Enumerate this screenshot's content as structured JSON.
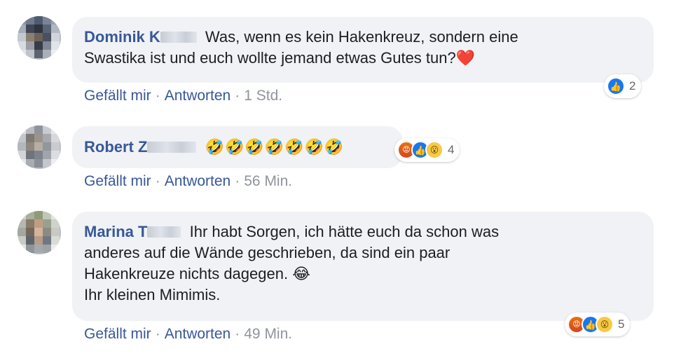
{
  "comments": [
    {
      "author": "Dominik K",
      "text_line1": "Was, wenn es kein Hakenkreuz, sondern eine",
      "text_line2": "Swastika ist und euch wollte jemand etwas Gutes tun?",
      "heart": "❤️",
      "like": "Gefällt mir",
      "reply": "Antworten",
      "time": "1 Std.",
      "reaction_count": "2",
      "reactions": [
        "like-icon"
      ]
    },
    {
      "author": "Robert Z",
      "emojis": "🤣🤣🤣🤣🤣🤣🤣",
      "like": "Gefällt mir",
      "reply": "Antworten",
      "time": "56 Min.",
      "reaction_count": "4",
      "reactions": [
        "angry-icon",
        "like-icon",
        "wow-icon"
      ]
    },
    {
      "author": "Marina T",
      "text_line1": "Ihr habt Sorgen, ich hätte euch da schon was",
      "text_line2": "anderes auf die Wände geschrieben, da sind ein paar",
      "text_line3": "Hakenkreuze nichts dagegen. 😂",
      "text_line4": "Ihr kleinen Mimimis.",
      "like": "Gefällt mir",
      "reply": "Antworten",
      "time": "49 Min.",
      "reaction_count": "5",
      "reactions": [
        "angry-icon",
        "like-icon",
        "wow-icon"
      ]
    }
  ],
  "separator": "·",
  "colors": {
    "name": "#385898",
    "bubble": "#f0f2f5",
    "meta": "#90949c",
    "like": "#1877f2"
  }
}
